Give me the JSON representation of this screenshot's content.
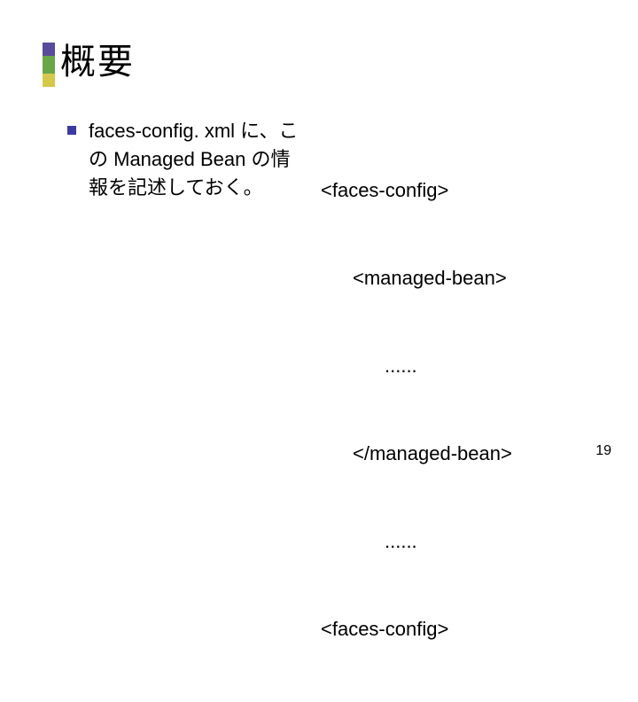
{
  "title": "概要",
  "left": {
    "bullet": "faces-config. xml に、この Managed Bean の情報を記述しておく。"
  },
  "right": {
    "line1": "<faces-config>",
    "line2": "<managed-bean>",
    "line3": "......",
    "line4": "</managed-bean>",
    "line5": "......",
    "line6": "<faces-config>"
  },
  "page_number": "19"
}
